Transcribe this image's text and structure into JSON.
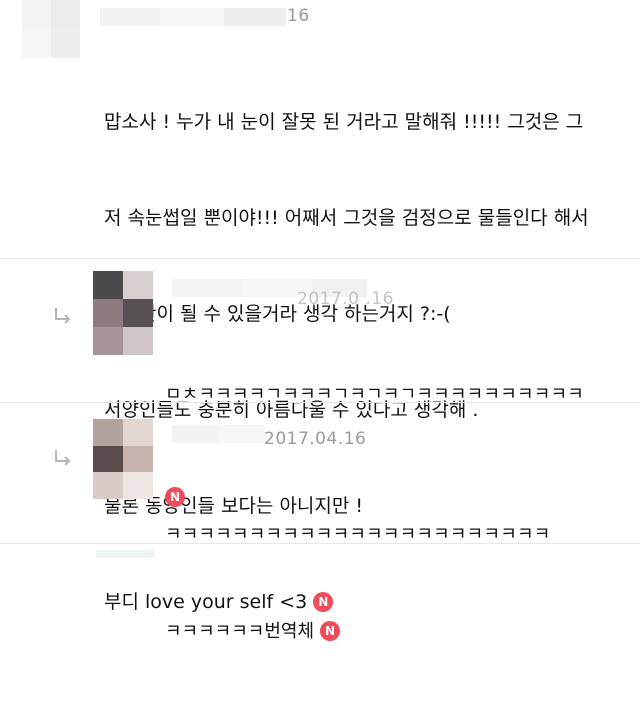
{
  "colors": {
    "badge": "#ef4b5a",
    "divider": "#e6e6e6",
    "meta_text": "#9a9a9a",
    "body_text": "#111111",
    "reply_arrow": "#b5b5b5"
  },
  "comments": [
    {
      "date": "16",
      "lines": [
        "맙소사 ! 누가 내 눈이 잘못 된 거라고 말해줘 !!!!! 그것은 그",
        "저 속눈썹일 뿐이야!!! 어째서 그것을 검정으로 물들인다 해서",
        "아시안이 될 수 있을거라 생각 하는거지 ?:-(",
        "서양인들도 충분히 아름다울 수 있다고 생각해 .",
        "물론 동양인들 보다는 아니지만 !",
        "부디 love your self <3"
      ],
      "badge": "N",
      "reply_icon": ""
    },
    {
      "date": "2017.0 .16",
      "lines": [
        "ㅁㅊㅋㅋㅋㅋㄱㅋㅋㅋㄱㅋㄱㅋㄱㅋㅋㅋㅋㅋㅋㅋㅋㅋㅋ"
      ],
      "badge": "N",
      "reply_icon": "reply-arrow-icon"
    },
    {
      "date": "2017.04.16",
      "lines": [
        "ㅋㅋㅋㅋㅋㅋㅋㅋㅋㅋㅋㅋㅋㅋㅋㅋㅋㅋㅋㅋㅋㅋㅋ",
        "ㅋㅋㅋㅋㅋㅋ번역체"
      ],
      "badge": "N",
      "reply_icon": "reply-arrow-icon"
    }
  ]
}
